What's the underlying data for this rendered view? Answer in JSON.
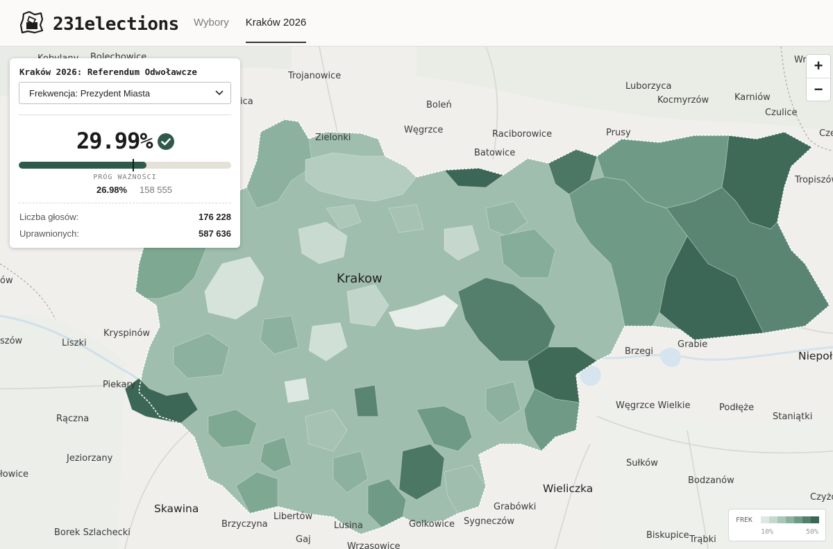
{
  "header": {
    "brand": "231elections",
    "nav": [
      {
        "label": "Wybory",
        "active": false
      },
      {
        "label": "Kraków 2026",
        "active": true
      }
    ]
  },
  "panel": {
    "title": "Kraków 2026: Referendum Odwoławcze",
    "select_value": "Frekwencja: Prezydent Miasta",
    "turnout_value": "29.99%",
    "turnout_fraction": 0.2999,
    "threshold_fraction": 0.2698,
    "threshold_label": "PRÓG WAŻNOŚCI",
    "threshold_pct": "26.98%",
    "threshold_votes": "158 555",
    "stats": [
      {
        "label": "Liczba głosów:",
        "value": "176 228"
      },
      {
        "label": "Uprawnionych:",
        "value": "587 636"
      }
    ]
  },
  "zoom": {
    "in": "+",
    "out": "−"
  },
  "legend": {
    "title": "FREK",
    "min": "10%",
    "max": "50%",
    "colors": [
      "#dde8e2",
      "#c4d8cd",
      "#a9c6b6",
      "#8cb19e",
      "#6f9b86",
      "#537f6c",
      "#3c6655"
    ]
  },
  "map": {
    "city_label": "Krakow",
    "places": [
      "Kobylany",
      "Bolechowice",
      "Trojanowice",
      "Luborzyca",
      "Karniów",
      "Wró",
      "Kocmyrzów",
      "Czulice",
      "Boleń",
      "Węgrzce",
      "Raciborowice",
      "Prusy",
      "Zielonki",
      "Batowice",
      "Cze",
      "Tropiszów",
      "Brzegi",
      "Grabie",
      "Niepoło",
      "Liszki",
      "Kryspinów",
      "Piekary",
      "Rączna",
      "Jeziorzany",
      "Skawina",
      "Borek Szlachecki",
      "Brzyczyna",
      "Libertów",
      "Gaj",
      "Lusina",
      "Wrząsowice",
      "Golkowice",
      "Sygneczów",
      "Grabówki",
      "Wieliczka",
      "Sułków",
      "Bodzanów",
      "Biskupice",
      "Trąbki",
      "Węgrzce Wielkie",
      "Podłęże",
      "Staniątki",
      "Czyżó",
      "ica",
      "ów",
      "szów",
      "łowice"
    ]
  }
}
